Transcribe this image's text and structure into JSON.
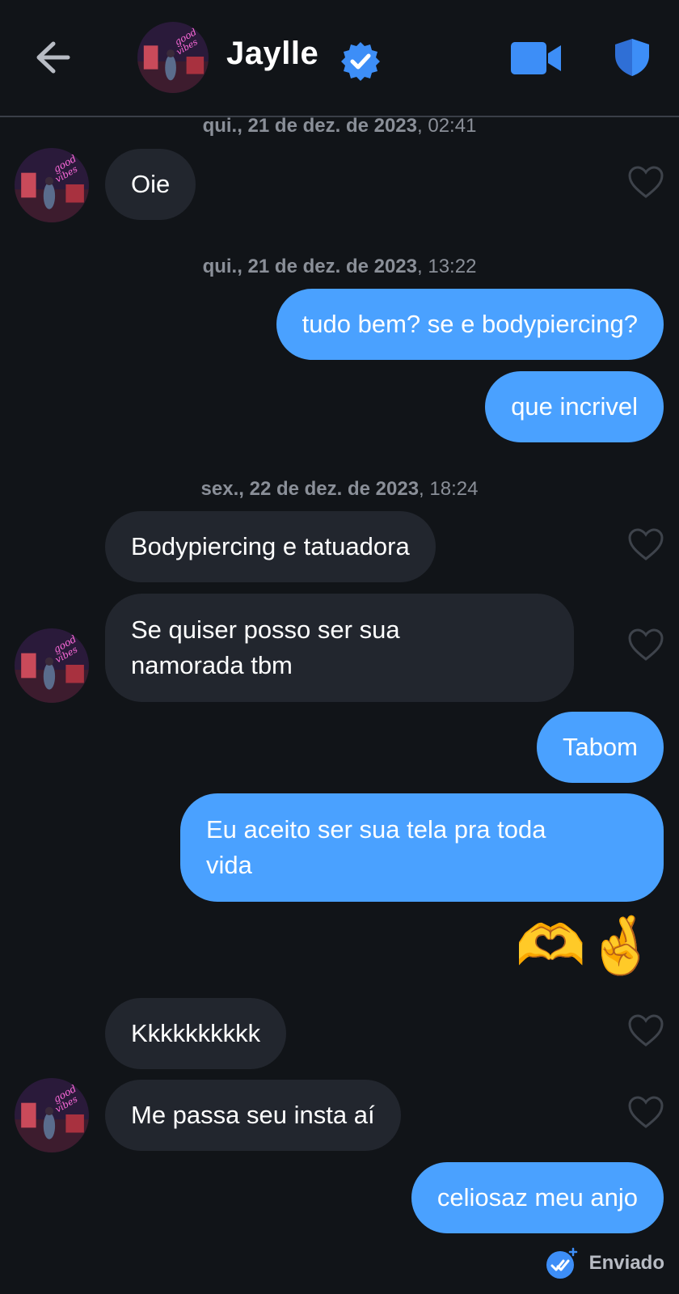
{
  "header": {
    "contact_name": "Jaylle",
    "back_icon": "arrow-left-icon",
    "verified_icon": "verified-badge-icon",
    "video_icon": "video-camera-icon",
    "safety_icon": "shield-icon",
    "accent": "#4aa1ff"
  },
  "timestamps": [
    {
      "day": "qui., 21 de dez. de 2023",
      "time": ", 02:41"
    },
    {
      "day": "qui., 21 de dez. de 2023",
      "time": ", 13:22"
    },
    {
      "day": "sex., 22 de dez. de 2023",
      "time": ", 18:24"
    }
  ],
  "messages": [
    {
      "from": "them",
      "text": "Oie"
    },
    {
      "from": "me",
      "text": "tudo bem? se e bodypiercing?"
    },
    {
      "from": "me",
      "text": "que incrivel"
    },
    {
      "from": "them",
      "text": "Bodypiercing e tatuadora"
    },
    {
      "from": "them",
      "text_lines": [
        "Se quiser posso ser sua",
        "namorada tbm"
      ]
    },
    {
      "from": "me",
      "text": "Tabom"
    },
    {
      "from": "me",
      "text_lines": [
        "Eu aceito ser sua tela pra toda",
        "vida"
      ]
    },
    {
      "from": "me",
      "emoji": "🫶🤞"
    },
    {
      "from": "them",
      "text": "Kkkkkkkkkk"
    },
    {
      "from": "them",
      "text": "Me passa seu insta aí"
    },
    {
      "from": "me",
      "text": "celiosaz meu anjo"
    }
  ],
  "status": {
    "label": "Enviado",
    "icon": "double-check-icon"
  },
  "colors": {
    "background": "#111418",
    "incoming_bubble": "#22262e",
    "outgoing_bubble": "#4aa1ff",
    "timestamp": "#8a8f98"
  }
}
